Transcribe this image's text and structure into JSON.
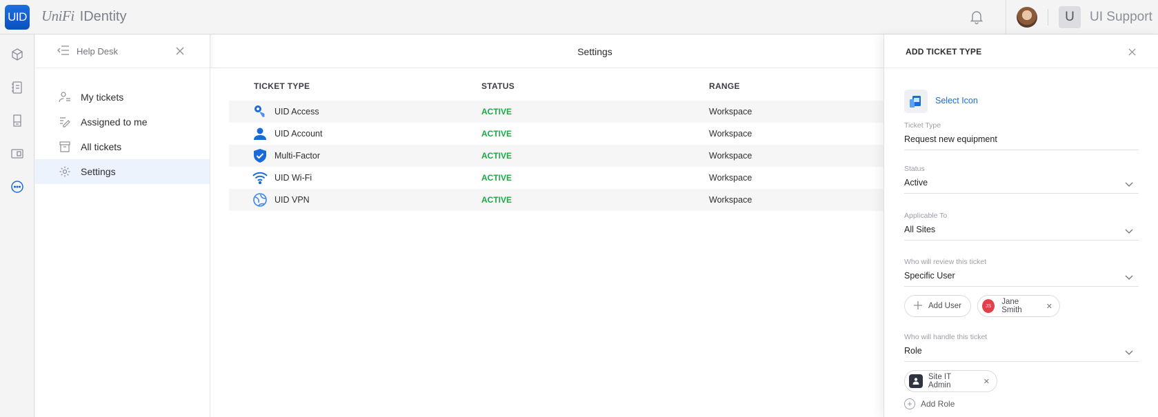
{
  "app": {
    "logo_text": "UID",
    "brand_unifi": "UniFi",
    "brand_name": "IDentity",
    "user_initial": "U",
    "user_name": "UI Support"
  },
  "rail": {
    "icons": [
      "cube-icon",
      "address-book-icon",
      "device-icon",
      "monitor-icon",
      "chat-more-icon"
    ],
    "active": "chat-more-icon"
  },
  "sidebar": {
    "title": "Help Desk",
    "items": [
      {
        "label": "My tickets",
        "icon": "person-list-icon"
      },
      {
        "label": "Assigned to me",
        "icon": "assigned-icon"
      },
      {
        "label": "All tickets",
        "icon": "archive-icon"
      },
      {
        "label": "Settings",
        "icon": "gear-icon",
        "active": true
      }
    ]
  },
  "main": {
    "title": "Settings",
    "columns": [
      "TICKET TYPE",
      "STATUS",
      "RANGE"
    ],
    "rows": [
      {
        "type": "UID Access",
        "status": "ACTIVE",
        "range": "Workspace",
        "icon": "key-icon"
      },
      {
        "type": "UID Account",
        "status": "ACTIVE",
        "range": "Workspace",
        "icon": "person-icon"
      },
      {
        "type": "Multi-Factor",
        "status": "ACTIVE",
        "range": "Workspace",
        "icon": "shield-check-icon"
      },
      {
        "type": "UID Wi-Fi",
        "status": "ACTIVE",
        "range": "Workspace",
        "icon": "wifi-icon"
      },
      {
        "type": "UID VPN",
        "status": "ACTIVE",
        "range": "Workspace",
        "icon": "globe-icon"
      }
    ]
  },
  "panel": {
    "title": "ADD TICKET TYPE",
    "select_icon_label": "Select Icon",
    "ticket_type_label": "Ticket Type",
    "ticket_type_value": "Request new equipment",
    "status_label": "Status",
    "status_value": "Active",
    "applicable_label": "Applicable To",
    "applicable_value": "All Sites",
    "review_label": "Who will review this ticket",
    "review_value": "Specific User",
    "add_user_label": "Add User",
    "reviewer_initials": "JS",
    "reviewer_name": "Jane Smith",
    "handle_label": "Who will handle this ticket",
    "handle_value": "Role",
    "role_chip_label": "Site IT Admin",
    "add_role_label": "Add Role"
  },
  "colors": {
    "accent": "#1a6bd9",
    "status_active": "#1ea844",
    "logo_bg": "#0b4fc0",
    "reviewer_avatar": "#e0424a"
  }
}
